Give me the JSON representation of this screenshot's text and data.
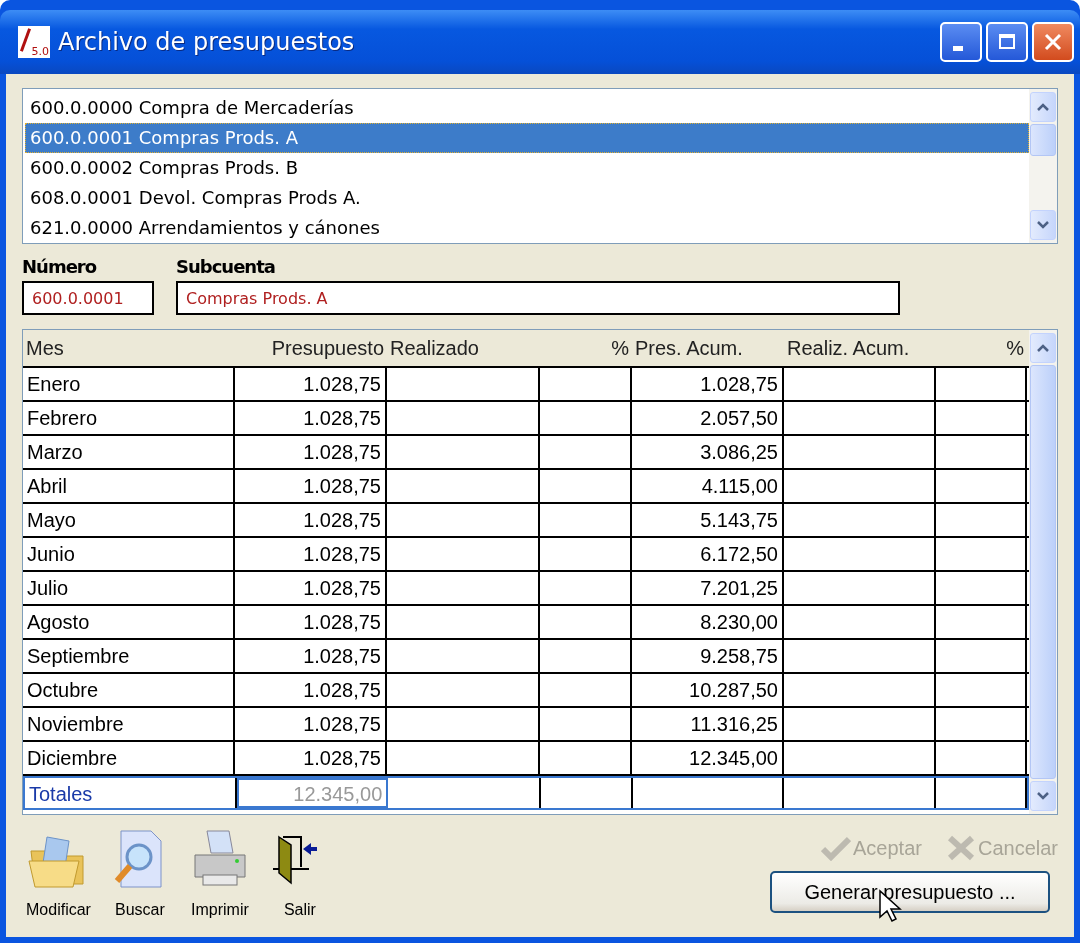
{
  "window": {
    "title": "Archivo de presupuestos",
    "icon_label": "5.0"
  },
  "accounts": [
    {
      "text": "600.0.0000 Compra de Mercaderías",
      "selected": false
    },
    {
      "text": "600.0.0001 Compras Prods. A",
      "selected": true
    },
    {
      "text": "600.0.0002 Compras Prods. B",
      "selected": false
    },
    {
      "text": "608.0.0001 Devol. Compras Prods A.",
      "selected": false
    },
    {
      "text": "621.0.0000 Arrendamientos y cánones",
      "selected": false
    }
  ],
  "fields": [
    {
      "label": "Número",
      "value": "600.0.0001",
      "kind": "short"
    },
    {
      "label": "Subcuenta",
      "value": "Compras Prods. A",
      "kind": "long"
    }
  ],
  "table": {
    "columns": [
      "Mes",
      "Presupuesto",
      "Realizado",
      "%",
      "Pres. Acum.",
      "Realiz. Acum.",
      "%"
    ],
    "rows": [
      {
        "mes": "Enero",
        "presupuesto": "1.028,75",
        "pres_acum": "1.028,75"
      },
      {
        "mes": "Febrero",
        "presupuesto": "1.028,75",
        "pres_acum": "2.057,50"
      },
      {
        "mes": "Marzo",
        "presupuesto": "1.028,75",
        "pres_acum": "3.086,25"
      },
      {
        "mes": "Abril",
        "presupuesto": "1.028,75",
        "pres_acum": "4.115,00"
      },
      {
        "mes": "Mayo",
        "presupuesto": "1.028,75",
        "pres_acum": "5.143,75"
      },
      {
        "mes": "Junio",
        "presupuesto": "1.028,75",
        "pres_acum": "6.172,50"
      },
      {
        "mes": "Julio",
        "presupuesto": "1.028,75",
        "pres_acum": "7.201,25"
      },
      {
        "mes": "Agosto",
        "presupuesto": "1.028,75",
        "pres_acum": "8.230,00"
      },
      {
        "mes": "Septiembre",
        "presupuesto": "1.028,75",
        "pres_acum": "9.258,75"
      },
      {
        "mes": "Octubre",
        "presupuesto": "1.028,75",
        "pres_acum": "10.287,50"
      },
      {
        "mes": "Noviembre",
        "presupuesto": "1.028,75",
        "pres_acum": "11.316,25"
      },
      {
        "mes": "Diciembre",
        "presupuesto": "1.028,75",
        "pres_acum": "12.345,00"
      }
    ],
    "totals": {
      "label": "Totales",
      "presupuesto": "12.345,00"
    }
  },
  "toolbar": [
    {
      "label": "Modificar",
      "kind": "folder"
    },
    {
      "label": "Buscar",
      "kind": "search"
    },
    {
      "label": "Imprimir",
      "kind": "printer"
    },
    {
      "label": "Salir",
      "kind": "exit"
    }
  ],
  "actions": [
    {
      "label": "Aceptar",
      "kind": "check",
      "disabled": true
    },
    {
      "label": "Cancelar",
      "kind": "cross",
      "disabled": true
    }
  ],
  "generate_button": {
    "label": "Generar presupuesto ..."
  }
}
